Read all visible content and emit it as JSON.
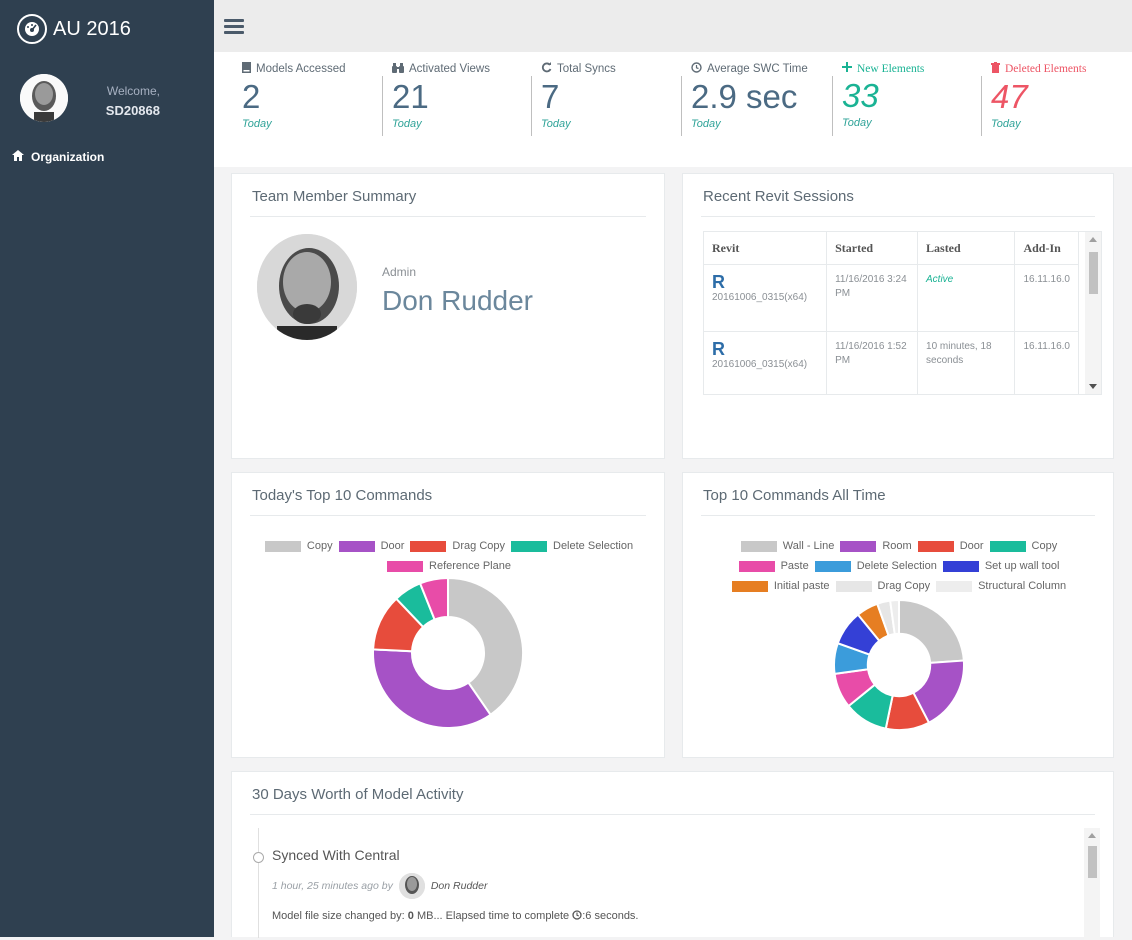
{
  "sidebar": {
    "app_title": "AU 2016",
    "welcome": "Welcome,",
    "username": "SD20868",
    "nav": [
      {
        "label": "Organization",
        "icon": "home-icon"
      }
    ]
  },
  "stats": [
    {
      "label": "Models Accessed",
      "icon": "book-icon",
      "value": "2",
      "sub": "Today"
    },
    {
      "label": "Activated Views",
      "icon": "binoculars-icon",
      "value": "21",
      "sub": "Today"
    },
    {
      "label": "Total Syncs",
      "icon": "refresh-icon",
      "value": "7",
      "sub": "Today"
    },
    {
      "label": "Average SWC Time",
      "icon": "clock-icon",
      "value": "2.9 sec",
      "sub": "Today"
    },
    {
      "label": "New Elements",
      "icon": "plus-icon",
      "value": "33",
      "sub": "Today",
      "color": "#1ab394"
    },
    {
      "label": "Deleted Elements",
      "icon": "trash-icon",
      "value": "47",
      "sub": "Today",
      "color": "#ed5565"
    }
  ],
  "team_summary": {
    "title": "Team Member Summary",
    "role": "Admin",
    "name": "Don Rudder"
  },
  "sessions": {
    "title": "Recent Revit Sessions",
    "headers": [
      "Revit",
      "Started",
      "Lasted",
      "Add-In"
    ],
    "rows": [
      {
        "revit": "20161006_0315(x64)",
        "started": "11/16/2016 3:24 PM",
        "lasted": "Active",
        "addin": "16.11.16.0"
      },
      {
        "revit": "20161006_0315(x64)",
        "started": "11/16/2016 1:52 PM",
        "lasted": "10 minutes, 18 seconds",
        "addin": "16.11.16.0"
      }
    ]
  },
  "today_commands": {
    "title": "Today's Top 10 Commands",
    "chart_data": {
      "type": "pie",
      "labels": [
        "Copy",
        "Door",
        "Drag Copy",
        "Delete Selection",
        "Reference Plane"
      ],
      "values": [
        40,
        35,
        12,
        6,
        6
      ],
      "colors": [
        "#c8c8c8",
        "#a652c6",
        "#e74c3c",
        "#1abc9c",
        "#e84ca8"
      ],
      "donut": true
    }
  },
  "alltime_commands": {
    "title": "Top 10 Commands All Time",
    "chart_data": {
      "type": "pie",
      "labels": [
        "Wall - Line",
        "Room",
        "Door",
        "Copy",
        "Paste",
        "Delete Selection",
        "Set up wall tool",
        "Initial paste",
        "Drag Copy",
        "Structural Column"
      ],
      "values": [
        22,
        17,
        10,
        10,
        8,
        7,
        8,
        5,
        3,
        2
      ],
      "colors": [
        "#c8c8c8",
        "#a652c6",
        "#e74c3c",
        "#1abc9c",
        "#e84ca8",
        "#3b9cdb",
        "#3440d6",
        "#e67e22",
        "#e6e6e6",
        "#ededed"
      ],
      "donut": true
    }
  },
  "activity": {
    "title": "30 Days Worth of Model Activity",
    "items": [
      {
        "title": "Synced With Central",
        "ago": "1 hour, 25 minutes ago by",
        "by": "Don Rudder",
        "detail_prefix": "Model file size changed by:",
        "detail_size": "0",
        "detail_mid": "MB... Elapsed time to complete",
        "detail_time": ":6 seconds."
      }
    ]
  }
}
